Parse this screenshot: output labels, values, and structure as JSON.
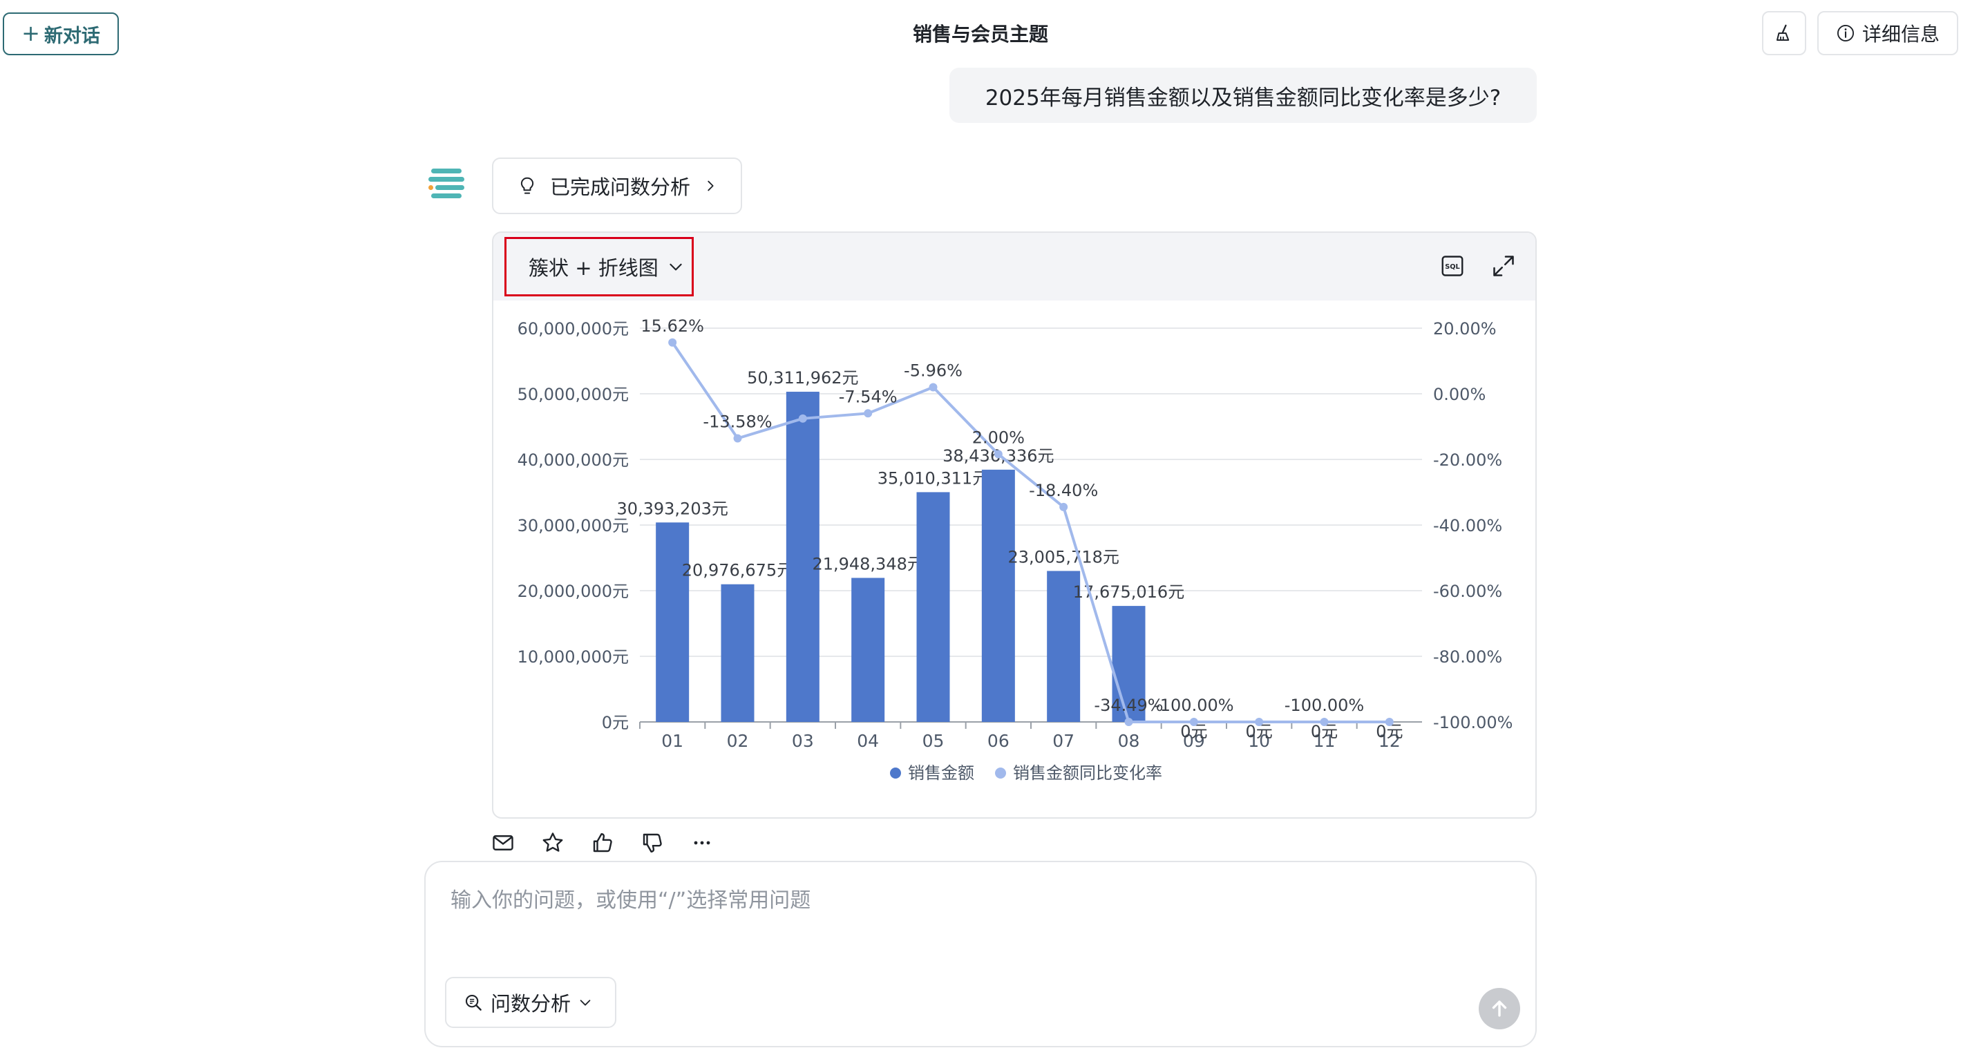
{
  "header": {
    "new_chat_label": "新对话",
    "title": "销售与会员主题",
    "detail_label": "详细信息"
  },
  "conversation": {
    "user_question": "2025年每月销售金额以及销售金额同比变化率是多少?",
    "analysis_status": "已完成问数分析"
  },
  "chart_card": {
    "chart_type_label": "簇状 + 折线图"
  },
  "chart_data": {
    "type": "bar",
    "categories": [
      "01",
      "02",
      "03",
      "04",
      "05",
      "06",
      "07",
      "08",
      "09",
      "10",
      "11",
      "12"
    ],
    "series": [
      {
        "name": "销售金额",
        "type": "bar",
        "axis": "left",
        "values": [
          30393203,
          20976675,
          50311962,
          21948348,
          35010311,
          38436336,
          23005718,
          17675016,
          0,
          0,
          0,
          0
        ],
        "labels": [
          "30,393,203元",
          "20,976,675元",
          "50,311,962元",
          "21,948,348元",
          "35,010,311元",
          "38,436,336元",
          "23,005,718元",
          "17,675,016元",
          "0元",
          "0元",
          "0元",
          "0元"
        ]
      },
      {
        "name": "销售金额同比变化率",
        "type": "line",
        "axis": "right",
        "values": [
          15.62,
          -13.58,
          -7.54,
          -5.96,
          2.0,
          -18.4,
          -34.49,
          -100.0,
          -100.0,
          -100.0,
          -100.0,
          -100.0
        ],
        "labels": [
          "15.62%",
          "-13.58%",
          "",
          "-7.54%",
          "-5.96%",
          "2.00%",
          "-18.40%",
          "-34.49%",
          "-100.00%",
          "",
          "-100.00%",
          ""
        ]
      }
    ],
    "y_left": {
      "min": 0,
      "max": 60000000,
      "ticks": [
        "0元",
        "10,000,000元",
        "20,000,000元",
        "30,000,000元",
        "40,000,000元",
        "50,000,000元",
        "60,000,000元"
      ]
    },
    "y_right": {
      "min": -100,
      "max": 20,
      "ticks": [
        "-100.00%",
        "-80.00%",
        "-60.00%",
        "-40.00%",
        "-20.00%",
        "0.00%",
        "20.00%"
      ]
    },
    "legend": [
      "销售金额",
      "销售金额同比变化率"
    ],
    "legend_position": "bottom",
    "grid": true,
    "colors": {
      "bar": "#4e78cb",
      "line": "#a1b9ec"
    }
  },
  "input": {
    "placeholder": "输入你的问题，或使用“/”选择常用问题",
    "mode_label": "问数分析"
  },
  "icons": {
    "action_row": [
      "mail-icon",
      "star-icon",
      "thumbs-up-icon",
      "thumbs-down-icon",
      "more-icon"
    ]
  }
}
